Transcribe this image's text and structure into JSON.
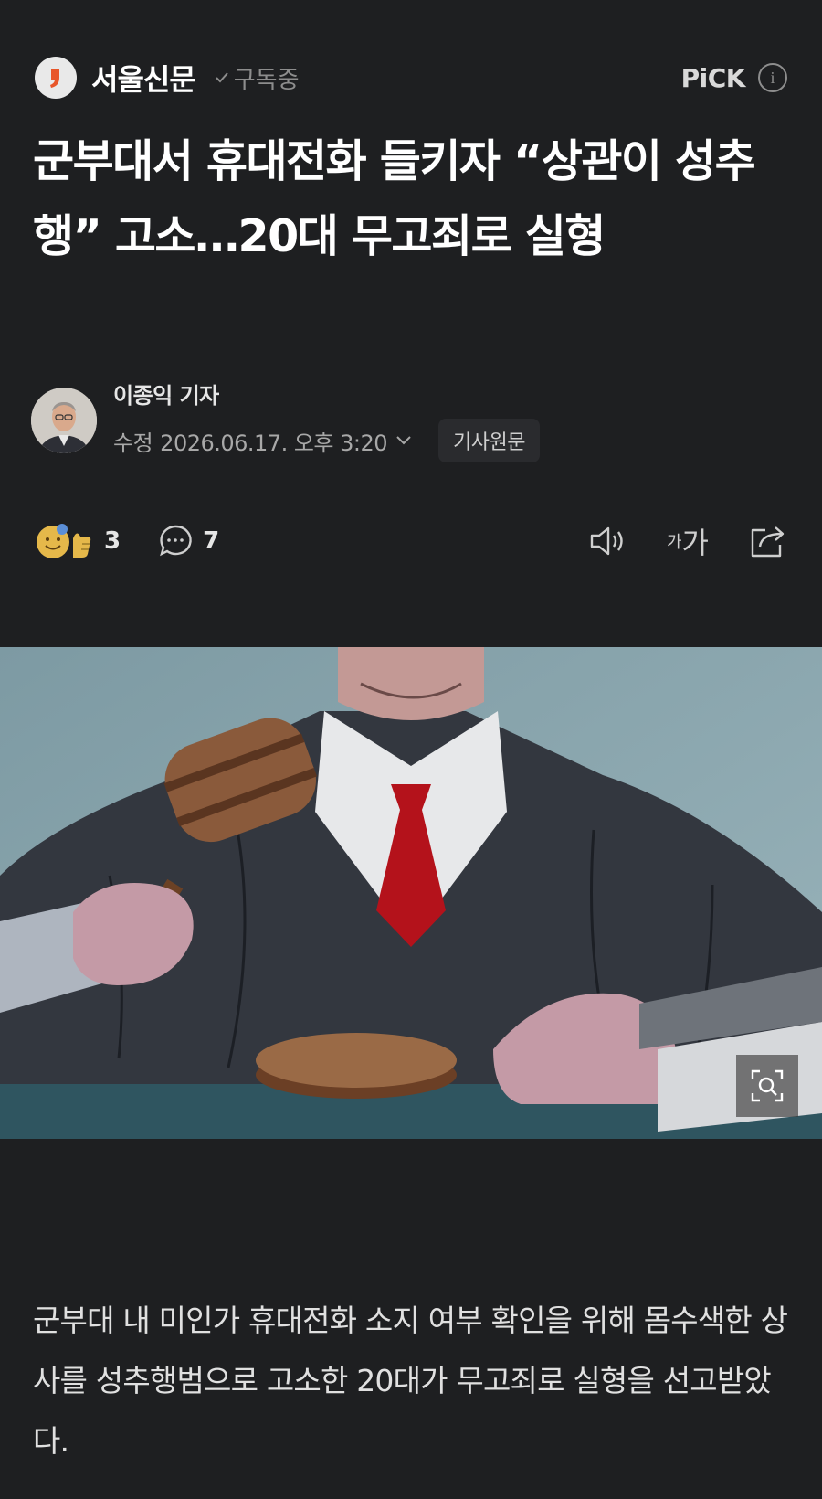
{
  "publisher": {
    "name": "서울신문",
    "subscribe_status": "구독중",
    "pick_label": "PiCK"
  },
  "article": {
    "headline": "군부대서 휴대전화 들키자 “상관이 성추행” 고소…20대 무고죄로 실형",
    "reporter": "이종익 기자",
    "date_label": "수정",
    "date": "2026.06.17. 오후 3:20",
    "original_button": "기사원문",
    "body": "군부대 내 미인가 휴대전화 소지 여부 확인을 위해 몸수색한 상사를 성추행범으로 고소한 20대가 무고죄로 실형을 선고받았다."
  },
  "actions": {
    "reaction_count": "3",
    "comment_count": "7",
    "font_size_small": "가",
    "font_size_large": "가"
  },
  "icons": {
    "publisher_logo": "seoul-shinmun-logo-icon",
    "subscribed": "check-icon",
    "info": "info-icon",
    "reaction": "reaction-emoji-icon",
    "comment": "comment-bubble-icon",
    "audio": "speaker-icon",
    "share": "share-icon",
    "zoom": "zoom-search-icon",
    "expand_date": "chevron-down-icon"
  },
  "colors": {
    "background": "#1e1f21",
    "headline": "#ffffff",
    "secondary_text": "#a8a8a8",
    "logo_accent": "#e8562a",
    "reaction_yellow": "#e5b84a"
  }
}
